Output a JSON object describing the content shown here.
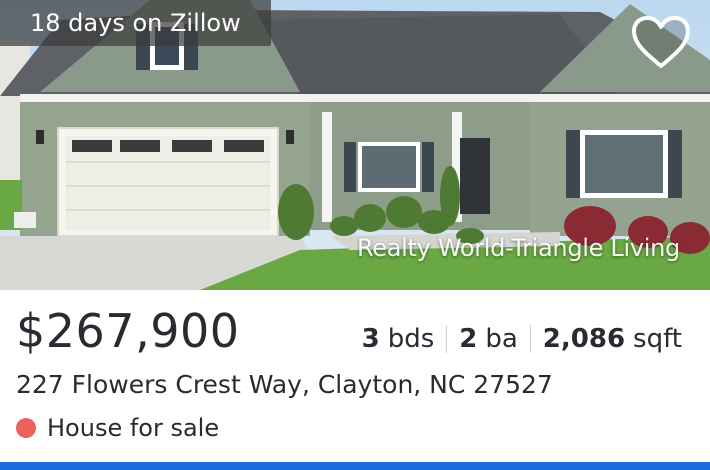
{
  "badge": {
    "text": "18 days on Zillow"
  },
  "favorite": {
    "icon": "heart-outline-icon"
  },
  "photo": {
    "watermark": "Realty World-Triangle Living"
  },
  "listing": {
    "price": "$267,900",
    "beds": {
      "value": "3",
      "unit": "bds"
    },
    "baths": {
      "value": "2",
      "unit": "ba"
    },
    "sqft": {
      "value": "2,086",
      "unit": "sqft"
    },
    "address": "227 Flowers Crest Way, Clayton, NC 27527",
    "status": "House for sale",
    "status_color": "#e8645a"
  },
  "accent_color": "#1c6bdd"
}
